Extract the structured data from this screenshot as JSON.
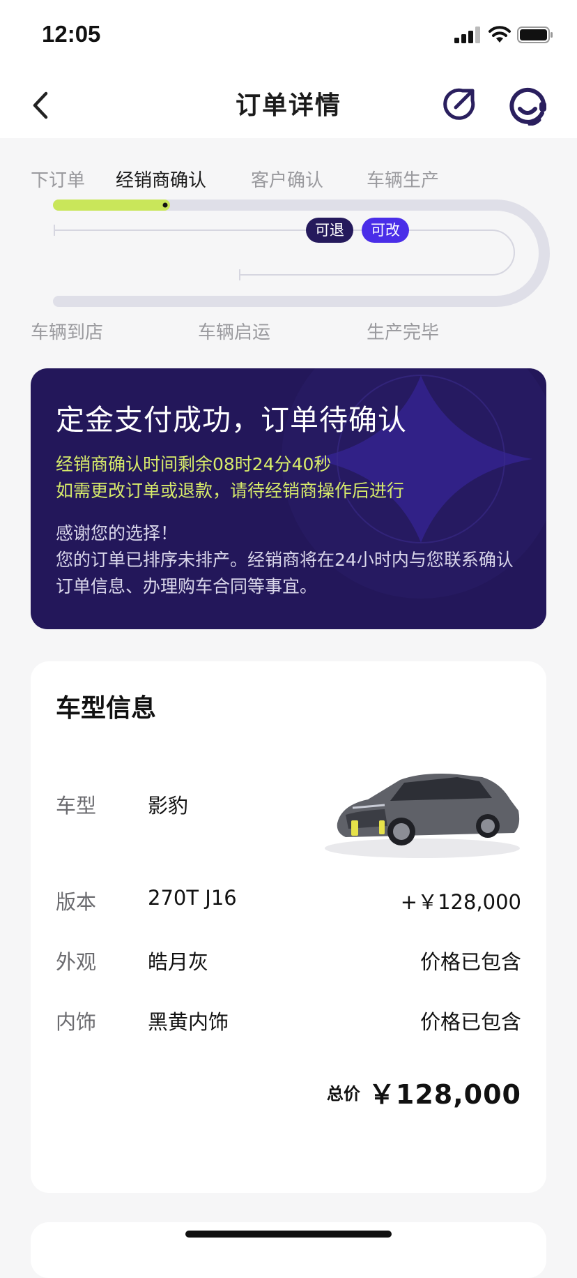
{
  "status_bar": {
    "time": "12:05"
  },
  "header": {
    "title": "订单详情"
  },
  "progress": {
    "top_steps": [
      "下订单",
      "经销商确认",
      "客户确认",
      "车辆生产"
    ],
    "bottom_steps": [
      "车辆到店",
      "车辆启运",
      "生产完毕"
    ],
    "active_step": "经销商确认",
    "badges": [
      "可退",
      "可改"
    ]
  },
  "banner": {
    "title": "定金支付成功，订单待确认",
    "highlight_line1": "经销商确认时间剩余08时24分40秒",
    "highlight_line2": "如需更改订单或退款，请待经销商操作后进行",
    "body_line1": "感谢您的选择！",
    "body_line2": "您的订单已排序未排产。经销商将在24小时内与您联系确认订单信息、办理购车合同等事宜。"
  },
  "vehicle_card": {
    "title": "车型信息",
    "rows": [
      {
        "label": "车型",
        "value": "影豹",
        "right": ""
      },
      {
        "label": "版本",
        "value": "270T J16",
        "right": "+￥128,000"
      },
      {
        "label": "外观",
        "value": "皓月灰",
        "right": "价格已包含"
      },
      {
        "label": "内饰",
        "value": "黑黄内饰",
        "right": "价格已包含"
      }
    ],
    "total_label": "总价",
    "total_value": "￥128,000"
  },
  "colors": {
    "accent_lime": "#c9e65a",
    "banner_bg": "#23175a",
    "badge_purple": "#4a2ee8",
    "badge_dark": "#251a5c"
  }
}
